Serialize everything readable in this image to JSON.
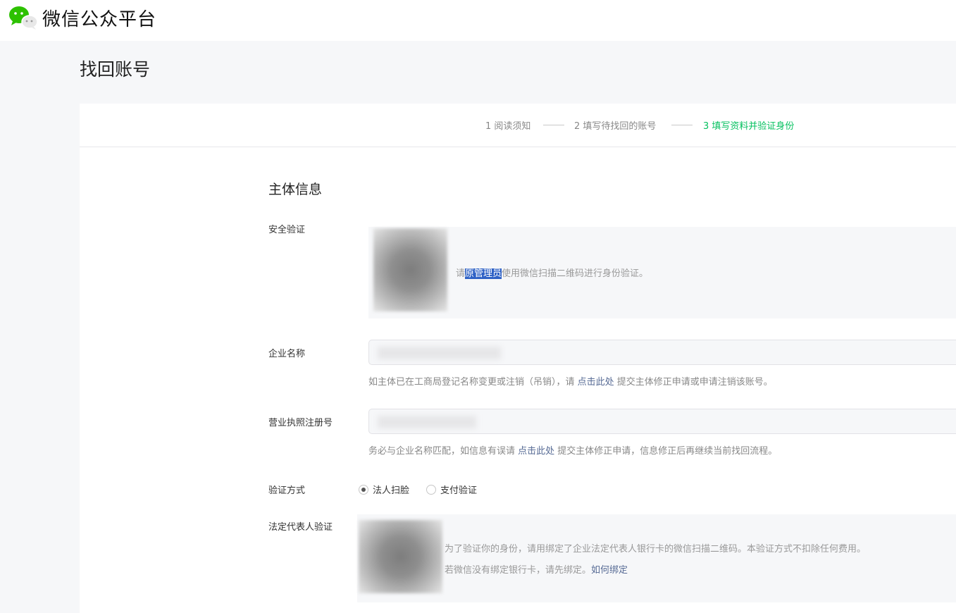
{
  "header": {
    "brand": "微信公众平台",
    "logo_icon": "wechat-logo-icon"
  },
  "page": {
    "title": "找回账号"
  },
  "steps": [
    {
      "label": "1 阅读须知",
      "active": false
    },
    {
      "label": "2 填写待找回的账号",
      "active": false
    },
    {
      "label": "3 填写资料并验证身份",
      "active": true
    }
  ],
  "form": {
    "section_title": "主体信息",
    "security": {
      "label": "安全验证",
      "text_before": "请",
      "text_highlight": "原管理员",
      "text_after": "使用微信扫描二维码进行身份验证。"
    },
    "company": {
      "label": "企业名称",
      "hint_before": "如主体已在工商局登记名称变更或注销（吊销），请 ",
      "hint_link": "点击此处",
      "hint_after": " 提交主体修正申请或申请注销该账号。"
    },
    "license": {
      "label": "营业执照注册号",
      "hint_before": "务必与企业名称匹配，如信息有误请 ",
      "hint_link": "点击此处",
      "hint_after": " 提交主体修正申请，信息修正后再继续当前找回流程。"
    },
    "verify_method": {
      "label": "验证方式",
      "options": [
        {
          "label": "法人扫脸",
          "checked": true
        },
        {
          "label": "支付验证",
          "checked": false
        }
      ]
    },
    "legal_rep": {
      "label": "法定代表人验证",
      "line1": "为了验证你的身份，请用绑定了企业法定代表人银行卡的微信扫描二维码。本验证方式不扣除任何费用。",
      "line2_before": "若微信没有绑定银行卡，请先绑定。",
      "line2_link": "如何绑定"
    }
  },
  "colors": {
    "accent": "#07c160",
    "link": "#576b95",
    "highlight": "#2f62c6"
  }
}
